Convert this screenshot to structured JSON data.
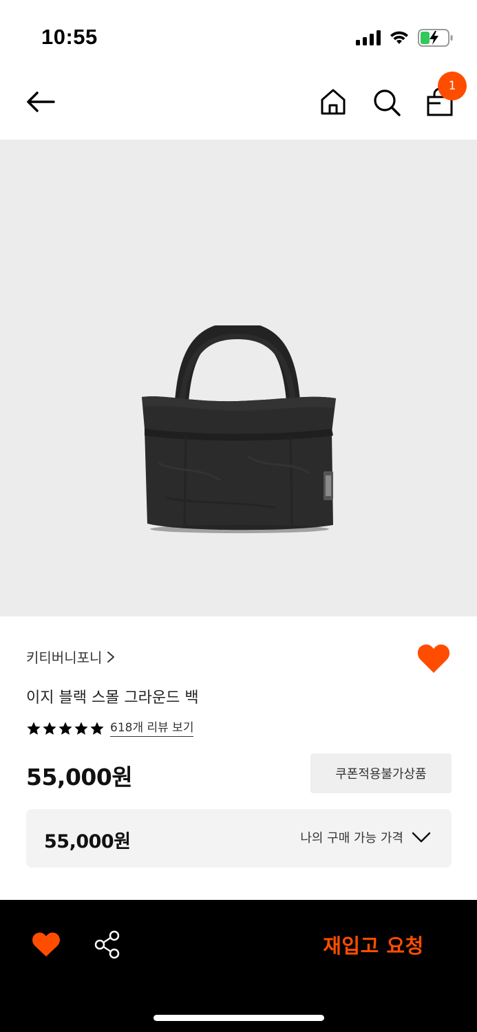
{
  "status_bar": {
    "time": "10:55"
  },
  "header": {
    "cart_count": "1"
  },
  "product": {
    "brand": "키티버니포니",
    "name": "이지 블랙 스몰 그라운드 백",
    "rating_stars": 5,
    "review_link": "618개 리뷰 보기",
    "price": "55,000원",
    "coupon_notice": "쿠폰적용불가상품",
    "my_price": {
      "value": "55,000원",
      "label": "나의 구매 가능 가격"
    }
  },
  "bottom_bar": {
    "restock_label": "재입고 요청"
  },
  "colors": {
    "accent": "#ff4d00",
    "image_bg": "#ececec",
    "bottom_bar_bg": "#000000"
  },
  "icons": [
    "signal-icon",
    "wifi-icon",
    "battery-icon",
    "back-arrow-icon",
    "home-icon",
    "search-icon",
    "shopping-bag-icon",
    "chevron-right-icon",
    "heart-icon",
    "star-icon",
    "chevron-down-icon",
    "share-icon"
  ]
}
